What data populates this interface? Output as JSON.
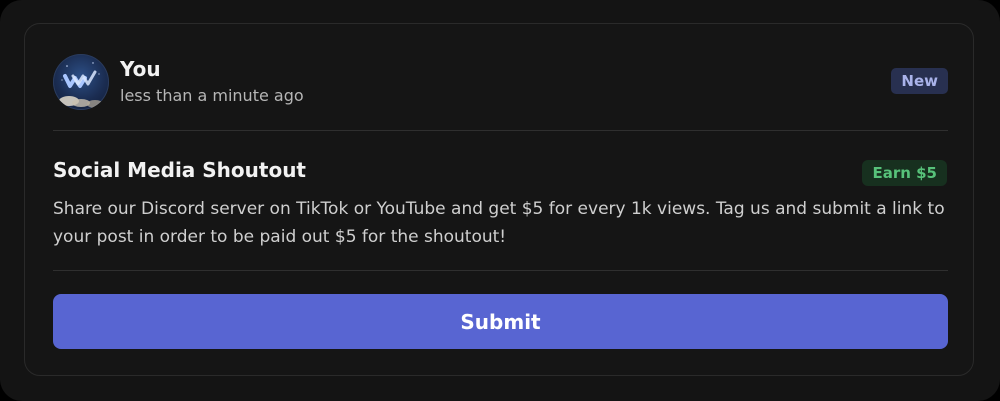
{
  "post": {
    "author": "You",
    "timestamp": "less than a minute ago",
    "status_badge": "New",
    "avatar_icon": "wave-logo-avatar"
  },
  "task": {
    "title": "Social Media Shoutout",
    "reward_badge": "Earn $5",
    "description": "Share our Discord server on TikTok or YouTube and get $5 for every 1k views. Tag us and submit a link to your post in order to be paid out $5 for the shoutout!"
  },
  "actions": {
    "submit_label": "Submit"
  },
  "colors": {
    "page_background": "#141414",
    "card_border": "#2a2a2a",
    "accent": "#5865d2",
    "new_badge_bg": "#283050",
    "new_badge_text": "#aab3ea",
    "earn_badge_bg": "#17301f",
    "earn_badge_text": "#57c27a"
  }
}
